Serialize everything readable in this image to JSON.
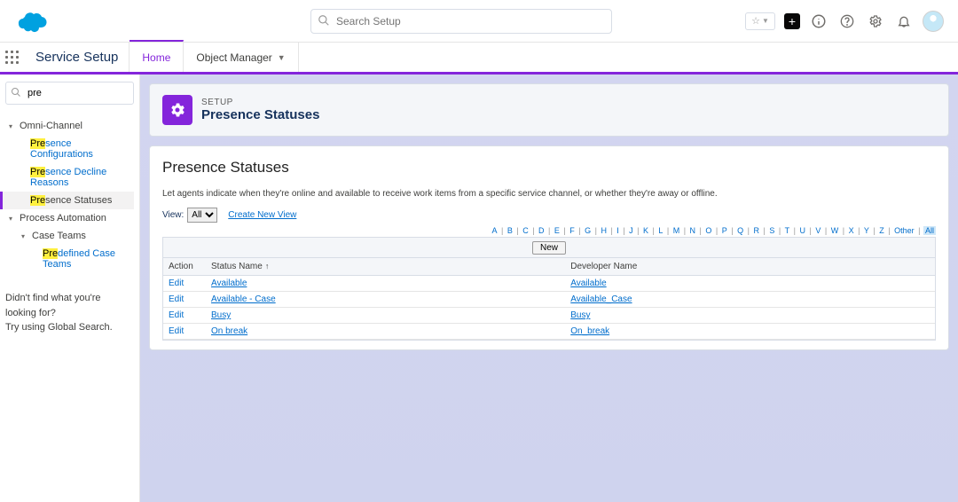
{
  "header": {
    "search_placeholder": "Search Setup"
  },
  "appbar": {
    "app_name": "Service Setup",
    "tabs": [
      {
        "label": "Home"
      },
      {
        "label": "Object Manager"
      }
    ]
  },
  "sidebar": {
    "search_value": "pre",
    "sections": [
      {
        "label": "Omni-Channel",
        "children": [
          {
            "label_pre_hl": "Pre",
            "label_rest": "sence Configurations"
          },
          {
            "label_pre_hl": "Pre",
            "label_rest": "sence Decline Reasons"
          },
          {
            "label_pre_hl": "Pre",
            "label_rest": "sence Statuses",
            "selected": true
          }
        ]
      },
      {
        "label": "Process Automation",
        "sub": {
          "label": "Case Teams",
          "children": [
            {
              "label_pre_hl": "Pre",
              "label_rest": "defined Case Teams"
            }
          ]
        }
      }
    ],
    "footer_l1": "Didn't find what you're looking for?",
    "footer_l2": "Try using Global Search."
  },
  "page_header": {
    "eyebrow": "SETUP",
    "title": "Presence Statuses"
  },
  "panel": {
    "heading": "Presence Statuses",
    "description": "Let agents indicate when they're online and available to receive work items from a specific service channel, or whether they're away or offline.",
    "view_label": "View:",
    "view_selected": "All",
    "create_view": "Create New View",
    "new_button": "New",
    "columns": {
      "action": "Action",
      "status": "Status Name",
      "dev": "Developer Name"
    },
    "rows": [
      {
        "action": "Edit",
        "status": "Available",
        "dev": "Available"
      },
      {
        "action": "Edit",
        "status": "Available - Case",
        "dev": "Available_Case"
      },
      {
        "action": "Edit",
        "status": "Busy",
        "dev": "Busy"
      },
      {
        "action": "Edit",
        "status": "On break",
        "dev": "On_break"
      }
    ],
    "alpha": [
      "A",
      "B",
      "C",
      "D",
      "E",
      "F",
      "G",
      "H",
      "I",
      "J",
      "K",
      "L",
      "M",
      "N",
      "O",
      "P",
      "Q",
      "R",
      "S",
      "T",
      "U",
      "V",
      "W",
      "X",
      "Y",
      "Z"
    ],
    "alpha_other": "Other",
    "alpha_all": "All"
  }
}
